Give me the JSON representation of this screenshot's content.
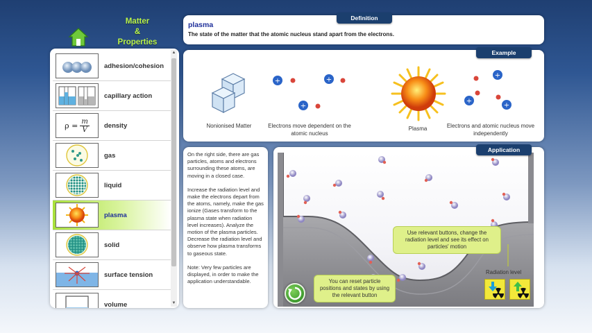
{
  "header": {
    "title_lines": [
      "Matter",
      "&",
      "Properties"
    ]
  },
  "sidebar": {
    "items": [
      {
        "label": "adhesion/cohesion",
        "thumb": "adhesion-thumb"
      },
      {
        "label": "capillary action",
        "thumb": "capillary-thumb"
      },
      {
        "label": "density",
        "thumb": "density-thumb"
      },
      {
        "label": "gas",
        "thumb": "gas-thumb"
      },
      {
        "label": "liquid",
        "thumb": "liquid-thumb"
      },
      {
        "label": "plasma",
        "thumb": "plasma-thumb",
        "active": true
      },
      {
        "label": "solid",
        "thumb": "solid-thumb"
      },
      {
        "label": "surface tension",
        "thumb": "surface-tension-thumb"
      },
      {
        "label": "volume",
        "thumb": "volume-thumb"
      }
    ],
    "density_formula": {
      "lhs": "ρ =",
      "num": "m",
      "den": "V"
    },
    "scroll_up": "▲",
    "scroll_down": "▼"
  },
  "definition": {
    "tab": "Definition",
    "word": "plasma",
    "text": "The state of the matter that the atomic nucleus stand apart from the electrons."
  },
  "example": {
    "tab": "Example",
    "captions": [
      "Nonionised Matter",
      "Electrons move dependent on the atomic nucleus",
      "Plasma",
      "Electrons and atomic nucleus move independently"
    ]
  },
  "description": {
    "paragraphs": [
      "On the right side, there are gas particles, atoms and electrons surrounding these atoms, are moving in a closed case.",
      "Increase the radiation level and make the electrons depart from the atoms, namely, make the gas ionize (Gases transform to the plasma state when radiation level increases). Analyze the motion of the plasma particles. Decrease the radiation level and observe how plasma transforms to gaseous state.",
      "Note: Very few particles are displayed, in order to make the application understandable."
    ]
  },
  "application": {
    "tab": "Application",
    "callout_buttons": "Use relevant buttons, change the radiation level and see its effect on particles' motion",
    "callout_reset": "You can reset particle positions and states by using the relevant button",
    "radiation_label": "Radiation level",
    "plus_sign": "+",
    "minus_sign": "−"
  },
  "colors": {
    "accent_green": "#b9f24a",
    "tab_navy": "#1b3f6e",
    "definition_word": "#1e2f9a",
    "proton_blue": "#2a64c8",
    "electron_red": "#d9463a"
  }
}
